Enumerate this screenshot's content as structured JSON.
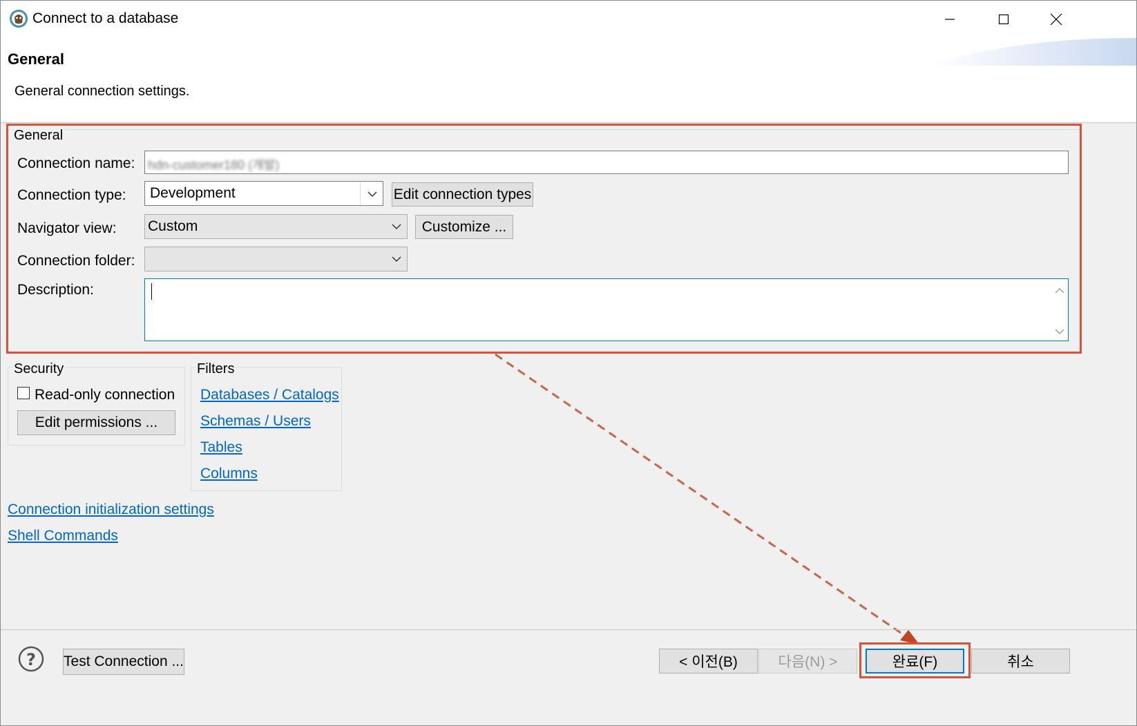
{
  "window": {
    "title": "Connect to a database"
  },
  "header": {
    "title": "General",
    "description": "General connection settings."
  },
  "general": {
    "group_label": "General",
    "connection_name_label": "Connection name:",
    "connection_name_value": "hdn-customer180 (개발)",
    "connection_type_label": "Connection type:",
    "connection_type_value": "Development",
    "edit_types_button": "Edit connection types",
    "navigator_view_label": "Navigator view:",
    "navigator_view_value": "Custom",
    "customize_button": "Customize ...",
    "connection_folder_label": "Connection folder:",
    "connection_folder_value": "",
    "description_label": "Description:",
    "description_value": ""
  },
  "security": {
    "group_label": "Security",
    "readonly_label": "Read-only connection",
    "readonly_checked": false,
    "edit_permissions_button": "Edit permissions ..."
  },
  "filters": {
    "group_label": "Filters",
    "links": [
      "Databases / Catalogs",
      "Schemas / Users",
      "Tables",
      "Columns"
    ]
  },
  "links": {
    "init_settings": "Connection initialization settings",
    "shell_commands": "Shell Commands"
  },
  "footer": {
    "test_connection": "Test Connection ...",
    "back": "< 이전(B)",
    "next": "다음(N) >",
    "finish": "완료(F)",
    "cancel": "취소"
  },
  "colors": {
    "highlight": "#d4533a",
    "link": "#0066cc",
    "focus": "#0078d7"
  }
}
